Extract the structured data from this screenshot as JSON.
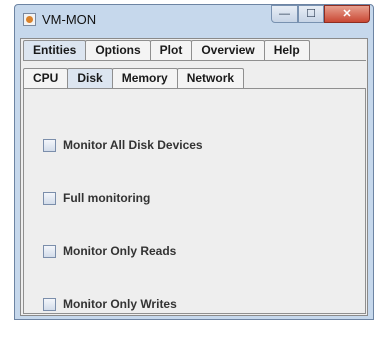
{
  "window": {
    "title": "VM-MON",
    "controls": {
      "minimize": "—",
      "maximize": "☐",
      "close": "✕"
    }
  },
  "main_tabs": [
    "Entities",
    "Options",
    "Plot",
    "Overview",
    "Help"
  ],
  "active_main_tab": "Entities",
  "sub_tabs": [
    "CPU",
    "Disk",
    "Memory",
    "Network"
  ],
  "active_sub_tab": "Disk",
  "checkboxes": [
    {
      "label": "Monitor All Disk Devices",
      "checked": false
    },
    {
      "label": "Full monitoring",
      "checked": false
    },
    {
      "label": "Monitor Only Reads",
      "checked": false
    },
    {
      "label": "Monitor Only Writes",
      "checked": false
    }
  ]
}
